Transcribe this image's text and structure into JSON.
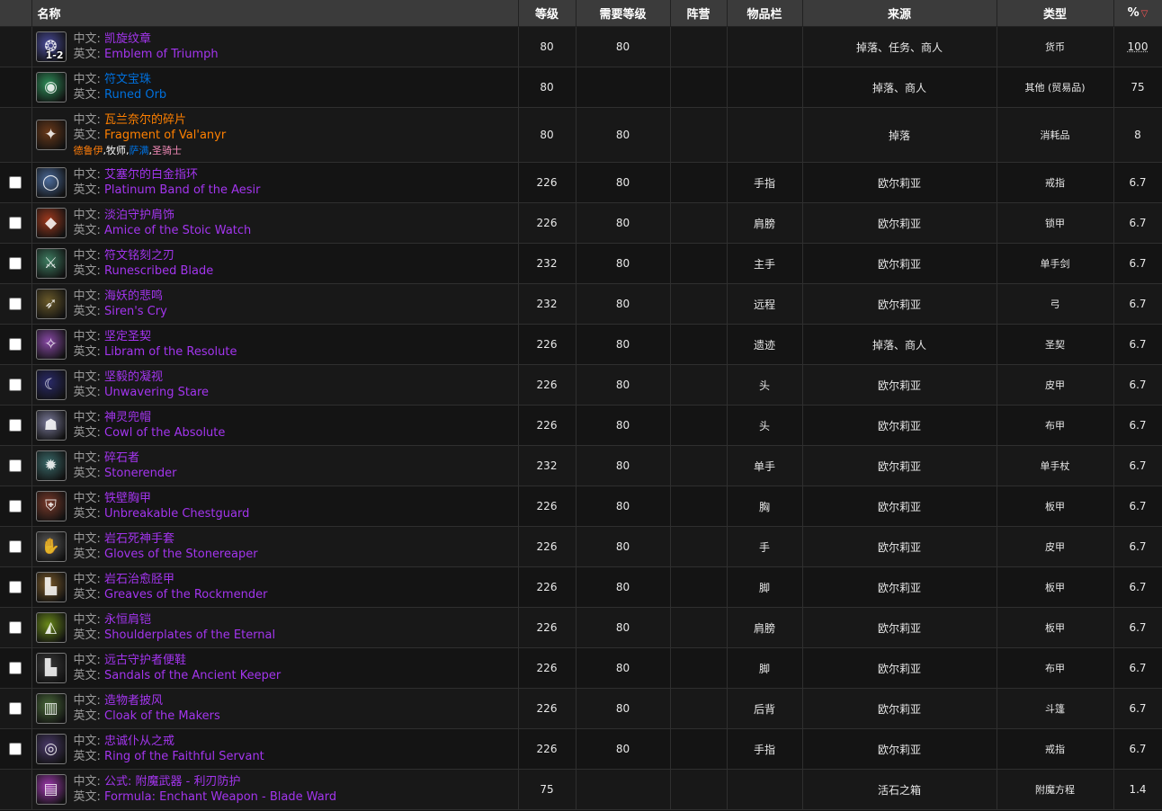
{
  "headers": {
    "name": "名称",
    "level": "等级",
    "req": "需要等级",
    "faction": "阵营",
    "slot": "物品栏",
    "source": "来源",
    "type": "类型",
    "pct": "%"
  },
  "zh_prefix": "中文:",
  "en_prefix": "英文:",
  "classes": [
    {
      "name": "德鲁伊",
      "sep": ","
    },
    {
      "name": "牧师",
      "sep": ","
    },
    {
      "name": "萨满",
      "sep": ","
    },
    {
      "name": "圣骑士",
      "sep": ""
    }
  ],
  "rows": [
    {
      "zh": "凯旋纹章",
      "en": "Emblem of Triumph",
      "quality": "purple",
      "icon": "emblem-icon",
      "glyph": "❂",
      "color": "#4a4c9c",
      "stack": "1-2",
      "ilvl": "80",
      "req": "80",
      "slot": "",
      "source": "掉落、任务、商人",
      "type": "货币",
      "pct": "100",
      "checkbox": false
    },
    {
      "zh": "符文宝珠",
      "en": "Runed Orb",
      "quality": "blue",
      "icon": "orb-icon",
      "glyph": "◉",
      "color": "#2f8f5a",
      "stack": "",
      "ilvl": "80",
      "req": "",
      "slot": "",
      "source": "掉落、商人",
      "type": "其他 (贸易品)",
      "pct": "75",
      "checkbox": false
    },
    {
      "zh": "瓦兰奈尔的碎片",
      "en": "Fragment of Val'anyr",
      "quality": "orange",
      "icon": "fragment-icon",
      "glyph": "✦",
      "color": "#6b3a1a",
      "stack": "",
      "ilvl": "80",
      "req": "80",
      "slot": "",
      "source": "掉落",
      "type": "消耗品",
      "pct": "8",
      "checkbox": false,
      "classes": true
    },
    {
      "zh": "艾塞尔的白金指环",
      "en": "Platinum Band of the Aesir",
      "quality": "purple",
      "icon": "ring-icon",
      "glyph": "◯",
      "color": "#4c6c9c",
      "stack": "",
      "ilvl": "226",
      "req": "80",
      "slot": "手指",
      "source": "欧尔莉亚",
      "type": "戒指",
      "pct": "6.7",
      "checkbox": true
    },
    {
      "zh": "淡泊守护肩饰",
      "en": "Amice of the Stoic Watch",
      "quality": "purple",
      "icon": "shoulder-icon",
      "glyph": "◆",
      "color": "#a03a1e",
      "stack": "",
      "ilvl": "226",
      "req": "80",
      "slot": "肩膀",
      "source": "欧尔莉亚",
      "type": "锁甲",
      "pct": "6.7",
      "checkbox": true
    },
    {
      "zh": "符文铭刻之刃",
      "en": "Runescribed Blade",
      "quality": "purple",
      "icon": "sword-icon",
      "glyph": "⚔",
      "color": "#3f7e62",
      "stack": "",
      "ilvl": "232",
      "req": "80",
      "slot": "主手",
      "source": "欧尔莉亚",
      "type": "单手剑",
      "pct": "6.7",
      "checkbox": true
    },
    {
      "zh": "海妖的悲鸣",
      "en": "Siren's Cry",
      "quality": "purple",
      "icon": "bow-icon",
      "glyph": "➶",
      "color": "#6a5a2a",
      "stack": "",
      "ilvl": "232",
      "req": "80",
      "slot": "远程",
      "source": "欧尔莉亚",
      "type": "弓",
      "pct": "6.7",
      "checkbox": true
    },
    {
      "zh": "坚定圣契",
      "en": "Libram of the Resolute",
      "quality": "purple",
      "icon": "libram-icon",
      "glyph": "✧",
      "color": "#8a4aa8",
      "stack": "",
      "ilvl": "226",
      "req": "80",
      "slot": "遗迹",
      "source": "掉落、商人",
      "type": "圣契",
      "pct": "6.7",
      "checkbox": true
    },
    {
      "zh": "坚毅的凝视",
      "en": "Unwavering Stare",
      "quality": "purple",
      "icon": "moon-icon",
      "glyph": "☾",
      "color": "#2a2a6a",
      "stack": "",
      "ilvl": "226",
      "req": "80",
      "slot": "头",
      "source": "欧尔莉亚",
      "type": "皮甲",
      "pct": "6.7",
      "checkbox": true
    },
    {
      "zh": "神灵兜帽",
      "en": "Cowl of the Absolute",
      "quality": "purple",
      "icon": "cowl-icon",
      "glyph": "☗",
      "color": "#7a7a9a",
      "stack": "",
      "ilvl": "226",
      "req": "80",
      "slot": "头",
      "source": "欧尔莉亚",
      "type": "布甲",
      "pct": "6.7",
      "checkbox": true
    },
    {
      "zh": "碎石者",
      "en": "Stonerender",
      "quality": "purple",
      "icon": "mace-icon",
      "glyph": "✹",
      "color": "#3a6a6a",
      "stack": "",
      "ilvl": "232",
      "req": "80",
      "slot": "单手",
      "source": "欧尔莉亚",
      "type": "单手杖",
      "pct": "6.7",
      "checkbox": true
    },
    {
      "zh": "铁壁胸甲",
      "en": "Unbreakable Chestguard",
      "quality": "purple",
      "icon": "chest-icon",
      "glyph": "⛨",
      "color": "#7a3a2a",
      "stack": "",
      "ilvl": "226",
      "req": "80",
      "slot": "胸",
      "source": "欧尔莉亚",
      "type": "板甲",
      "pct": "6.7",
      "checkbox": true
    },
    {
      "zh": "岩石死神手套",
      "en": "Gloves of the Stonereaper",
      "quality": "purple",
      "icon": "gloves-icon",
      "glyph": "✋",
      "color": "#5a5a5a",
      "stack": "",
      "ilvl": "226",
      "req": "80",
      "slot": "手",
      "source": "欧尔莉亚",
      "type": "皮甲",
      "pct": "6.7",
      "checkbox": true
    },
    {
      "zh": "岩石治愈胫甲",
      "en": "Greaves of the Rockmender",
      "quality": "purple",
      "icon": "boots-icon",
      "glyph": "▙",
      "color": "#7a5a2a",
      "stack": "",
      "ilvl": "226",
      "req": "80",
      "slot": "脚",
      "source": "欧尔莉亚",
      "type": "板甲",
      "pct": "6.7",
      "checkbox": true
    },
    {
      "zh": "永恒肩铠",
      "en": "Shoulderplates of the Eternal",
      "quality": "purple",
      "icon": "shoulderplate-icon",
      "glyph": "◭",
      "color": "#6a8a1a",
      "stack": "",
      "ilvl": "226",
      "req": "80",
      "slot": "肩膀",
      "source": "欧尔莉亚",
      "type": "板甲",
      "pct": "6.7",
      "checkbox": true
    },
    {
      "zh": "远古守护者便鞋",
      "en": "Sandals of the Ancient Keeper",
      "quality": "purple",
      "icon": "sandals-icon",
      "glyph": "▙",
      "color": "#3a3a3a",
      "stack": "",
      "ilvl": "226",
      "req": "80",
      "slot": "脚",
      "source": "欧尔莉亚",
      "type": "布甲",
      "pct": "6.7",
      "checkbox": true
    },
    {
      "zh": "造物者披风",
      "en": "Cloak of the Makers",
      "quality": "purple",
      "icon": "cloak-icon",
      "glyph": "▥",
      "color": "#4a6a3a",
      "stack": "",
      "ilvl": "226",
      "req": "80",
      "slot": "后背",
      "source": "欧尔莉亚",
      "type": "斗篷",
      "pct": "6.7",
      "checkbox": true
    },
    {
      "zh": "忠诚仆从之戒",
      "en": "Ring of the Faithful Servant",
      "quality": "purple",
      "icon": "ring-icon",
      "glyph": "◎",
      "color": "#4a3a6a",
      "stack": "",
      "ilvl": "226",
      "req": "80",
      "slot": "手指",
      "source": "欧尔莉亚",
      "type": "戒指",
      "pct": "6.7",
      "checkbox": true
    },
    {
      "zh": "公式: 附魔武器 - 利刃防护",
      "en": "Formula: Enchant Weapon - Blade Ward",
      "quality": "purple",
      "icon": "scroll-icon",
      "glyph": "▤",
      "color": "#a03ab0",
      "stack": "",
      "ilvl": "75",
      "req": "",
      "slot": "",
      "source": "活石之箱",
      "type": "附魔方程",
      "pct": "1.4",
      "checkbox": false
    }
  ]
}
